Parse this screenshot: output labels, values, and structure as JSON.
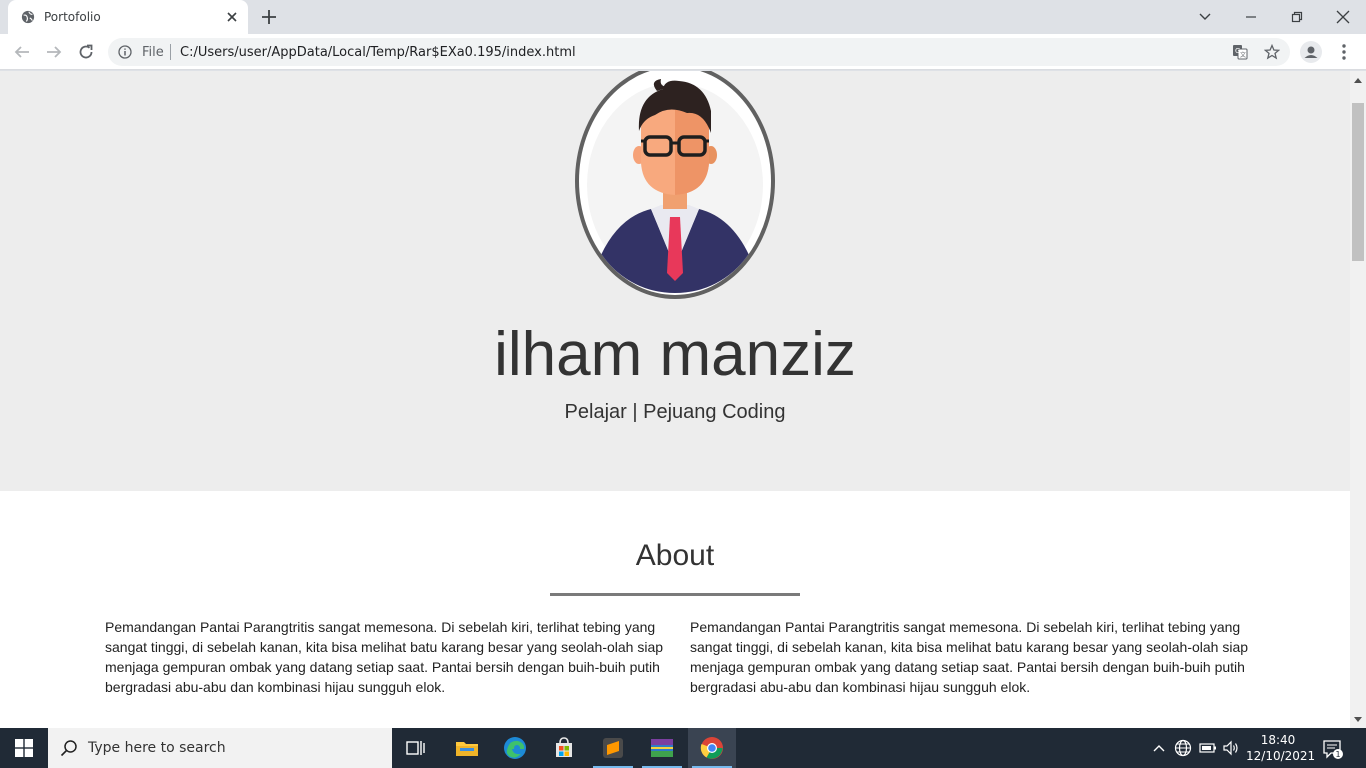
{
  "browser": {
    "tab_title": "Portofolio",
    "omnibox_file_label": "File",
    "url": "C:/Users/user/AppData/Local/Temp/Rar$EXa0.195/index.html"
  },
  "hero": {
    "name": "ilham manziz",
    "tagline": "Pelajar | Pejuang Coding"
  },
  "about": {
    "heading": "About",
    "left_paragraph": "Pemandangan Pantai Parangtritis sangat memesona. Di sebelah kiri, terlihat tebing yang sangat tinggi, di sebelah kanan, kita bisa melihat batu karang besar yang seolah-olah siap menjaga gempuran ombak yang datang setiap saat. Pantai bersih dengan buih-buih putih bergradasi abu-abu dan kombinasi hijau sungguh elok.",
    "right_paragraph": "Pemandangan Pantai Parangtritis sangat memesona. Di sebelah kiri, terlihat tebing yang sangat tinggi, di sebelah kanan, kita bisa melihat batu karang besar yang seolah-olah siap menjaga gempuran ombak yang datang setiap saat. Pantai bersih dengan buih-buih putih bergradasi abu-abu dan kombinasi hijau sungguh elok."
  },
  "taskbar": {
    "search_placeholder": "Type here to search",
    "time": "18:40",
    "date": "12/10/2021",
    "notification_count": "1",
    "apps": [
      "task-view",
      "file-explorer",
      "edge",
      "microsoft-store",
      "sublime-text",
      "winrar",
      "chrome"
    ]
  },
  "colors": {
    "hero_bg": "#ededed",
    "text": "#333333",
    "taskbar_bg": "#202a36"
  }
}
